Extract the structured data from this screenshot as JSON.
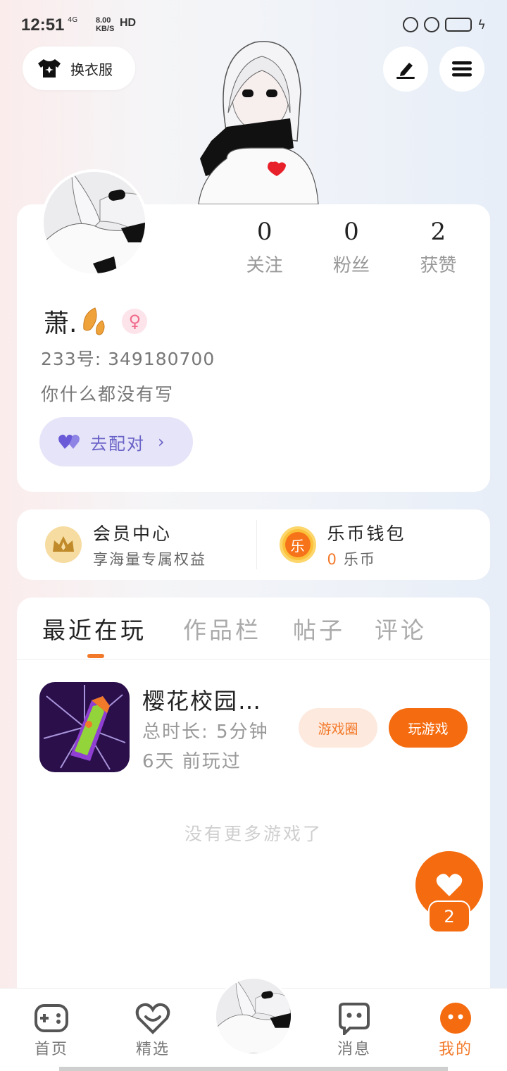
{
  "status_bar": {
    "time": "12:51",
    "network": "4G",
    "speed_value": "8.00",
    "speed_unit": "KB/S",
    "hd": "HD"
  },
  "header": {
    "outfit_label": "换衣服",
    "icons": [
      "shirt-icon",
      "edit-icon",
      "menu-icon"
    ]
  },
  "profile": {
    "stats": [
      {
        "value": "0",
        "label": "关注"
      },
      {
        "value": "0",
        "label": "粉丝"
      },
      {
        "value": "2",
        "label": "获赞"
      }
    ],
    "username": "萧.",
    "gender_symbol": "♀",
    "account_id": "233号: 349180700",
    "bio": "你什么都没有写",
    "match_label": "去配对"
  },
  "vip": {
    "member_title": "会员中心",
    "member_sub": "享海量专属权益",
    "wallet_title": "乐币钱包",
    "wallet_amount": "0",
    "wallet_unit": "乐币",
    "coin_char": "乐"
  },
  "tabs": [
    "最近在玩",
    "作品栏",
    "帖子",
    "评论"
  ],
  "recent_games": [
    {
      "name": "樱花校园…",
      "total_time": "总时长: 5分钟",
      "last_played": "6天 前玩过",
      "circle_label": "游戏圈",
      "play_label": "玩游戏"
    }
  ],
  "no_more_text": "没有更多游戏了",
  "like_count": "2",
  "bottom_nav": [
    {
      "label": "首页",
      "icon": "gamepad-icon"
    },
    {
      "label": "精选",
      "icon": "heart-chat-icon"
    },
    {
      "label": "消息",
      "icon": "message-icon"
    },
    {
      "label": "我的",
      "icon": "profile-face-icon"
    }
  ],
  "colors": {
    "accent": "#f56b0f",
    "accent_text": "#f3792a",
    "match_bg": "#e6e4f8",
    "match_text": "#6a63c8"
  }
}
